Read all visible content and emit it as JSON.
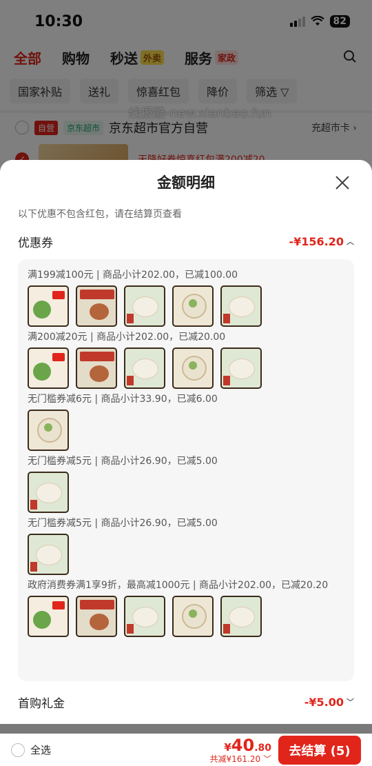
{
  "status": {
    "time": "10:30",
    "battery": "82"
  },
  "tabs": [
    {
      "label": "全部",
      "badge": ""
    },
    {
      "label": "购物",
      "badge": ""
    },
    {
      "label": "秒送",
      "badge": "外卖"
    },
    {
      "label": "服务",
      "badge": "家政"
    }
  ],
  "filters": [
    "国家补贴",
    "送礼",
    "惊喜红包",
    "降价",
    "筛选"
  ],
  "store": {
    "badge1": "自营",
    "badge2": "京东超市",
    "name": "京东超市官方自营",
    "right_link": "充超市卡"
  },
  "item": {
    "promo": "天降好券惊喜红包满200减20"
  },
  "watermark": "线报酷-new.xianbao.fun",
  "sheet": {
    "title": "金额明细",
    "note": "以下优惠不包含红包，请在结算页查看",
    "coupon_label": "优惠券",
    "coupon_amount": "-¥156.20",
    "groups": [
      {
        "text": "满199减100元 | 商品小计202.00，已减100.00"
      },
      {
        "text": "满200减20元 | 商品小计202.00，已减20.00"
      },
      {
        "text": "无门槛券减6元 | 商品小计33.90，已减6.00"
      },
      {
        "text": "无门槛券减5元 | 商品小计26.90，已减5.00"
      },
      {
        "text": "无门槛券减5元 | 商品小计26.90，已减5.00"
      },
      {
        "text": "政府消费券满1享9折，最高减1000元 | 商品小计202.00，已减20.20"
      }
    ],
    "firstbuy_label": "首购礼金",
    "firstbuy_amount": "-¥5.00"
  },
  "bottom": {
    "select_all": "全选",
    "currency": "¥",
    "price_int": "40",
    "price_dec": ".80",
    "total_discount": "共减¥161.20",
    "checkout": "去结算 (5)"
  }
}
